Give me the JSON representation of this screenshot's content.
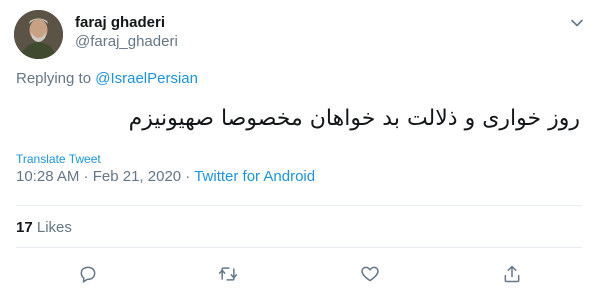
{
  "user": {
    "display_name": "faraj ghaderi",
    "handle": "@faraj_ghaderi"
  },
  "reply": {
    "prefix": "Replying to ",
    "target": "@IsraelPersian"
  },
  "tweet": {
    "text": "روز خواری و ذلالت بد خواهان مخصوصا صهیونیزم",
    "translate_label": "Translate Tweet",
    "time": "10:28 AM",
    "separator": " · ",
    "date": "Feb 21, 2020",
    "source": "Twitter for Android"
  },
  "stats": {
    "likes_count": "17",
    "likes_label": "Likes"
  },
  "actions": {
    "reply_icon": "reply-icon",
    "retweet_icon": "retweet-icon",
    "like_icon": "like-icon",
    "share_icon": "share-icon"
  },
  "colors": {
    "link": "#1b95e0",
    "secondary_text": "#657786",
    "primary_text": "#14171a",
    "divider": "#e6ecf0"
  }
}
